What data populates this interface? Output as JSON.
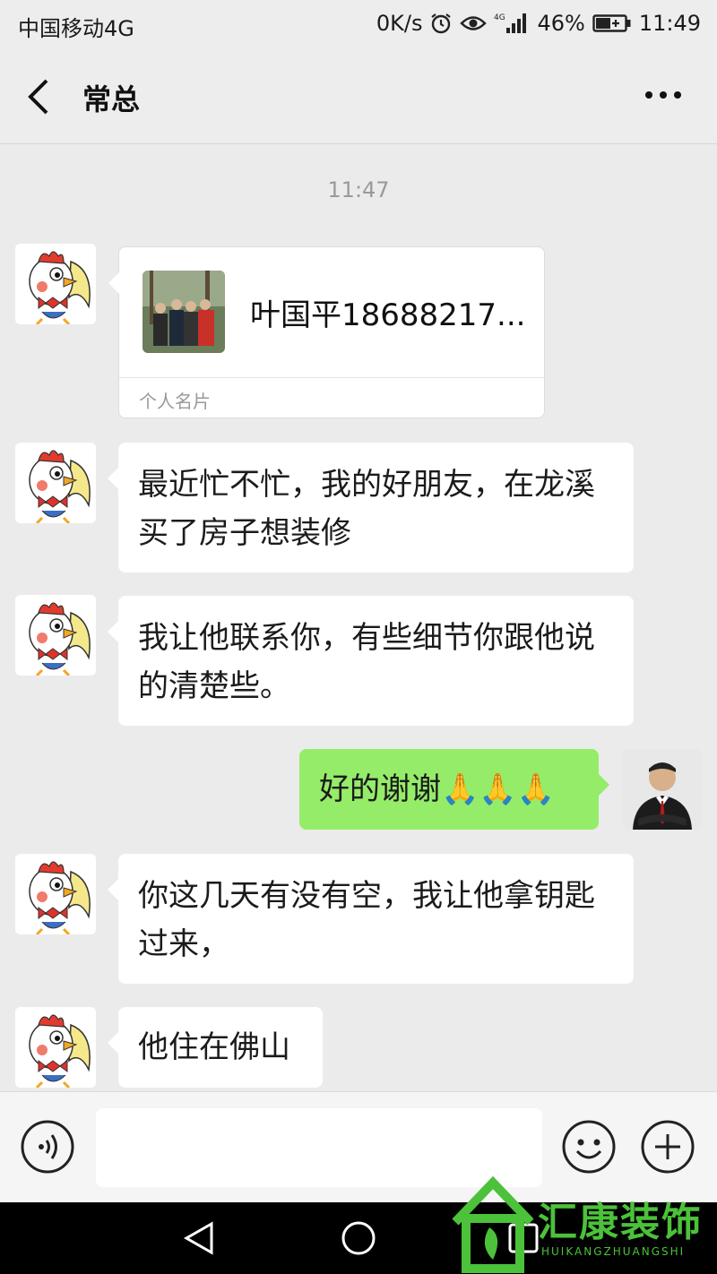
{
  "status_bar": {
    "carrier": "中国移动4G",
    "speed": "0K/s",
    "network": "4G",
    "battery": "46%",
    "time": "11:49"
  },
  "header": {
    "title": "常总"
  },
  "chat": {
    "timestamp": "11:47",
    "card": {
      "name": "叶国平18688217...",
      "label": "个人名片"
    },
    "messages": [
      {
        "side": "left",
        "text": "最近忙不忙，我的好朋友，在龙溪买了房子想装修"
      },
      {
        "side": "left",
        "text": "我让他联系你，有些细节你跟他说的清楚些。"
      },
      {
        "side": "right",
        "text": "好的谢谢🙏🙏🙏"
      },
      {
        "side": "left",
        "text": "你这几天有没有空，我让他拿钥匙过来，"
      },
      {
        "side": "left",
        "text": "他住在佛山"
      }
    ]
  },
  "input_bar": {
    "value": ""
  },
  "watermark": {
    "text": "汇康装饰",
    "sub": "HUIKANGZHUANGSHI"
  },
  "colors": {
    "bubble_right": "#95ec69",
    "bubble_left": "#ffffff",
    "background": "#ebebeb"
  }
}
